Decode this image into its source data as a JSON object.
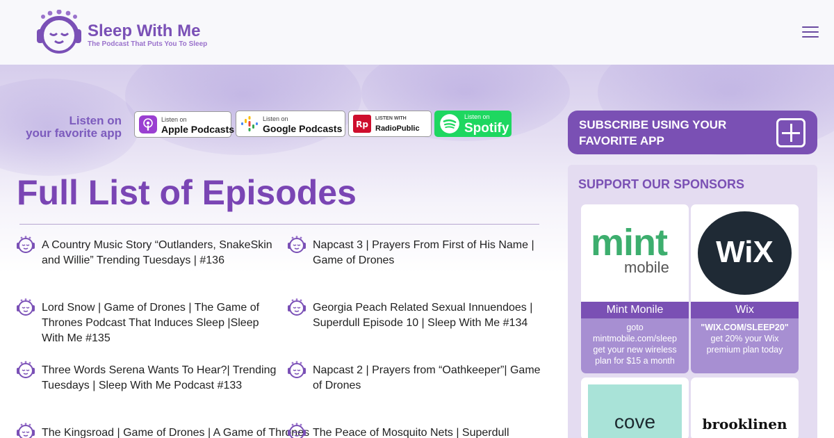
{
  "header": {
    "logo_title": "Sleep With Me",
    "logo_tagline": "The Podcast That Puts You To Sleep"
  },
  "listen": {
    "label_line1": "Listen on",
    "label_line2": "your favorite app",
    "badges": [
      {
        "small": "Listen on",
        "big": "Apple Podcasts"
      },
      {
        "small": "Listen on",
        "big": "Google Podcasts"
      },
      {
        "small": "LISTEN WITH",
        "big": "RadioPublic"
      },
      {
        "small": "Listen on",
        "big": "Spotify"
      }
    ]
  },
  "main": {
    "title": "Full List of Episodes",
    "episodes": [
      "A Country Music Story “Outlanders, SnakeSkin and Willie” Trending Tuesdays | #136",
      "Napcast 3 | Prayers From First of His Name | Game of Drones",
      "Lord Snow | Game of Drones | The Game of Thrones Podcast That Induces Sleep |Sleep With Me #135",
      "Georgia Peach Related Sexual Innuendoes | Superdull Episode 10 | Sleep With Me #134",
      "Three Words Serena Wants To Hear?| Trending Tuesdays | Sleep With Me Podcast #133",
      "Napcast 2 | Prayers from “Oathkeeper”| Game of Drones",
      "The Kingsroad | Game of Drones | A Game of Thrones",
      "The Peace of Mosquito Nets | Superdull"
    ]
  },
  "sidebar": {
    "subscribe_label": "SUBSCRIBE USING YOUR FAVORITE APP",
    "sponsors_title": "SUPPORT OUR SPONSORS",
    "sponsors": [
      {
        "logo_line1": "mint",
        "logo_line2": "mobile",
        "name": "Mint Monile",
        "desc_bold": "",
        "desc": "goto mintmobile.com/sleep get your new wireless plan for $15 a month"
      },
      {
        "logo_line1": "WiX",
        "logo_line2": "",
        "name": "Wix",
        "desc_bold": "\"WIX.COM/SLEEP20\"",
        "desc": "get 20% your Wix premium plan today"
      },
      {
        "logo_line1": "cove",
        "logo_line2": ""
      },
      {
        "logo_line1": "brooklinen",
        "logo_line2": ""
      }
    ]
  },
  "colors": {
    "brand_purple": "#7a50b4",
    "title_purple": "#7a45b4",
    "card_desc_bg": "#a78fd2",
    "spotify_green": "#1ed760",
    "mint_green": "#3dae6e",
    "wix_dark": "#1f2a35",
    "cove_bg": "#a9e3d8"
  }
}
